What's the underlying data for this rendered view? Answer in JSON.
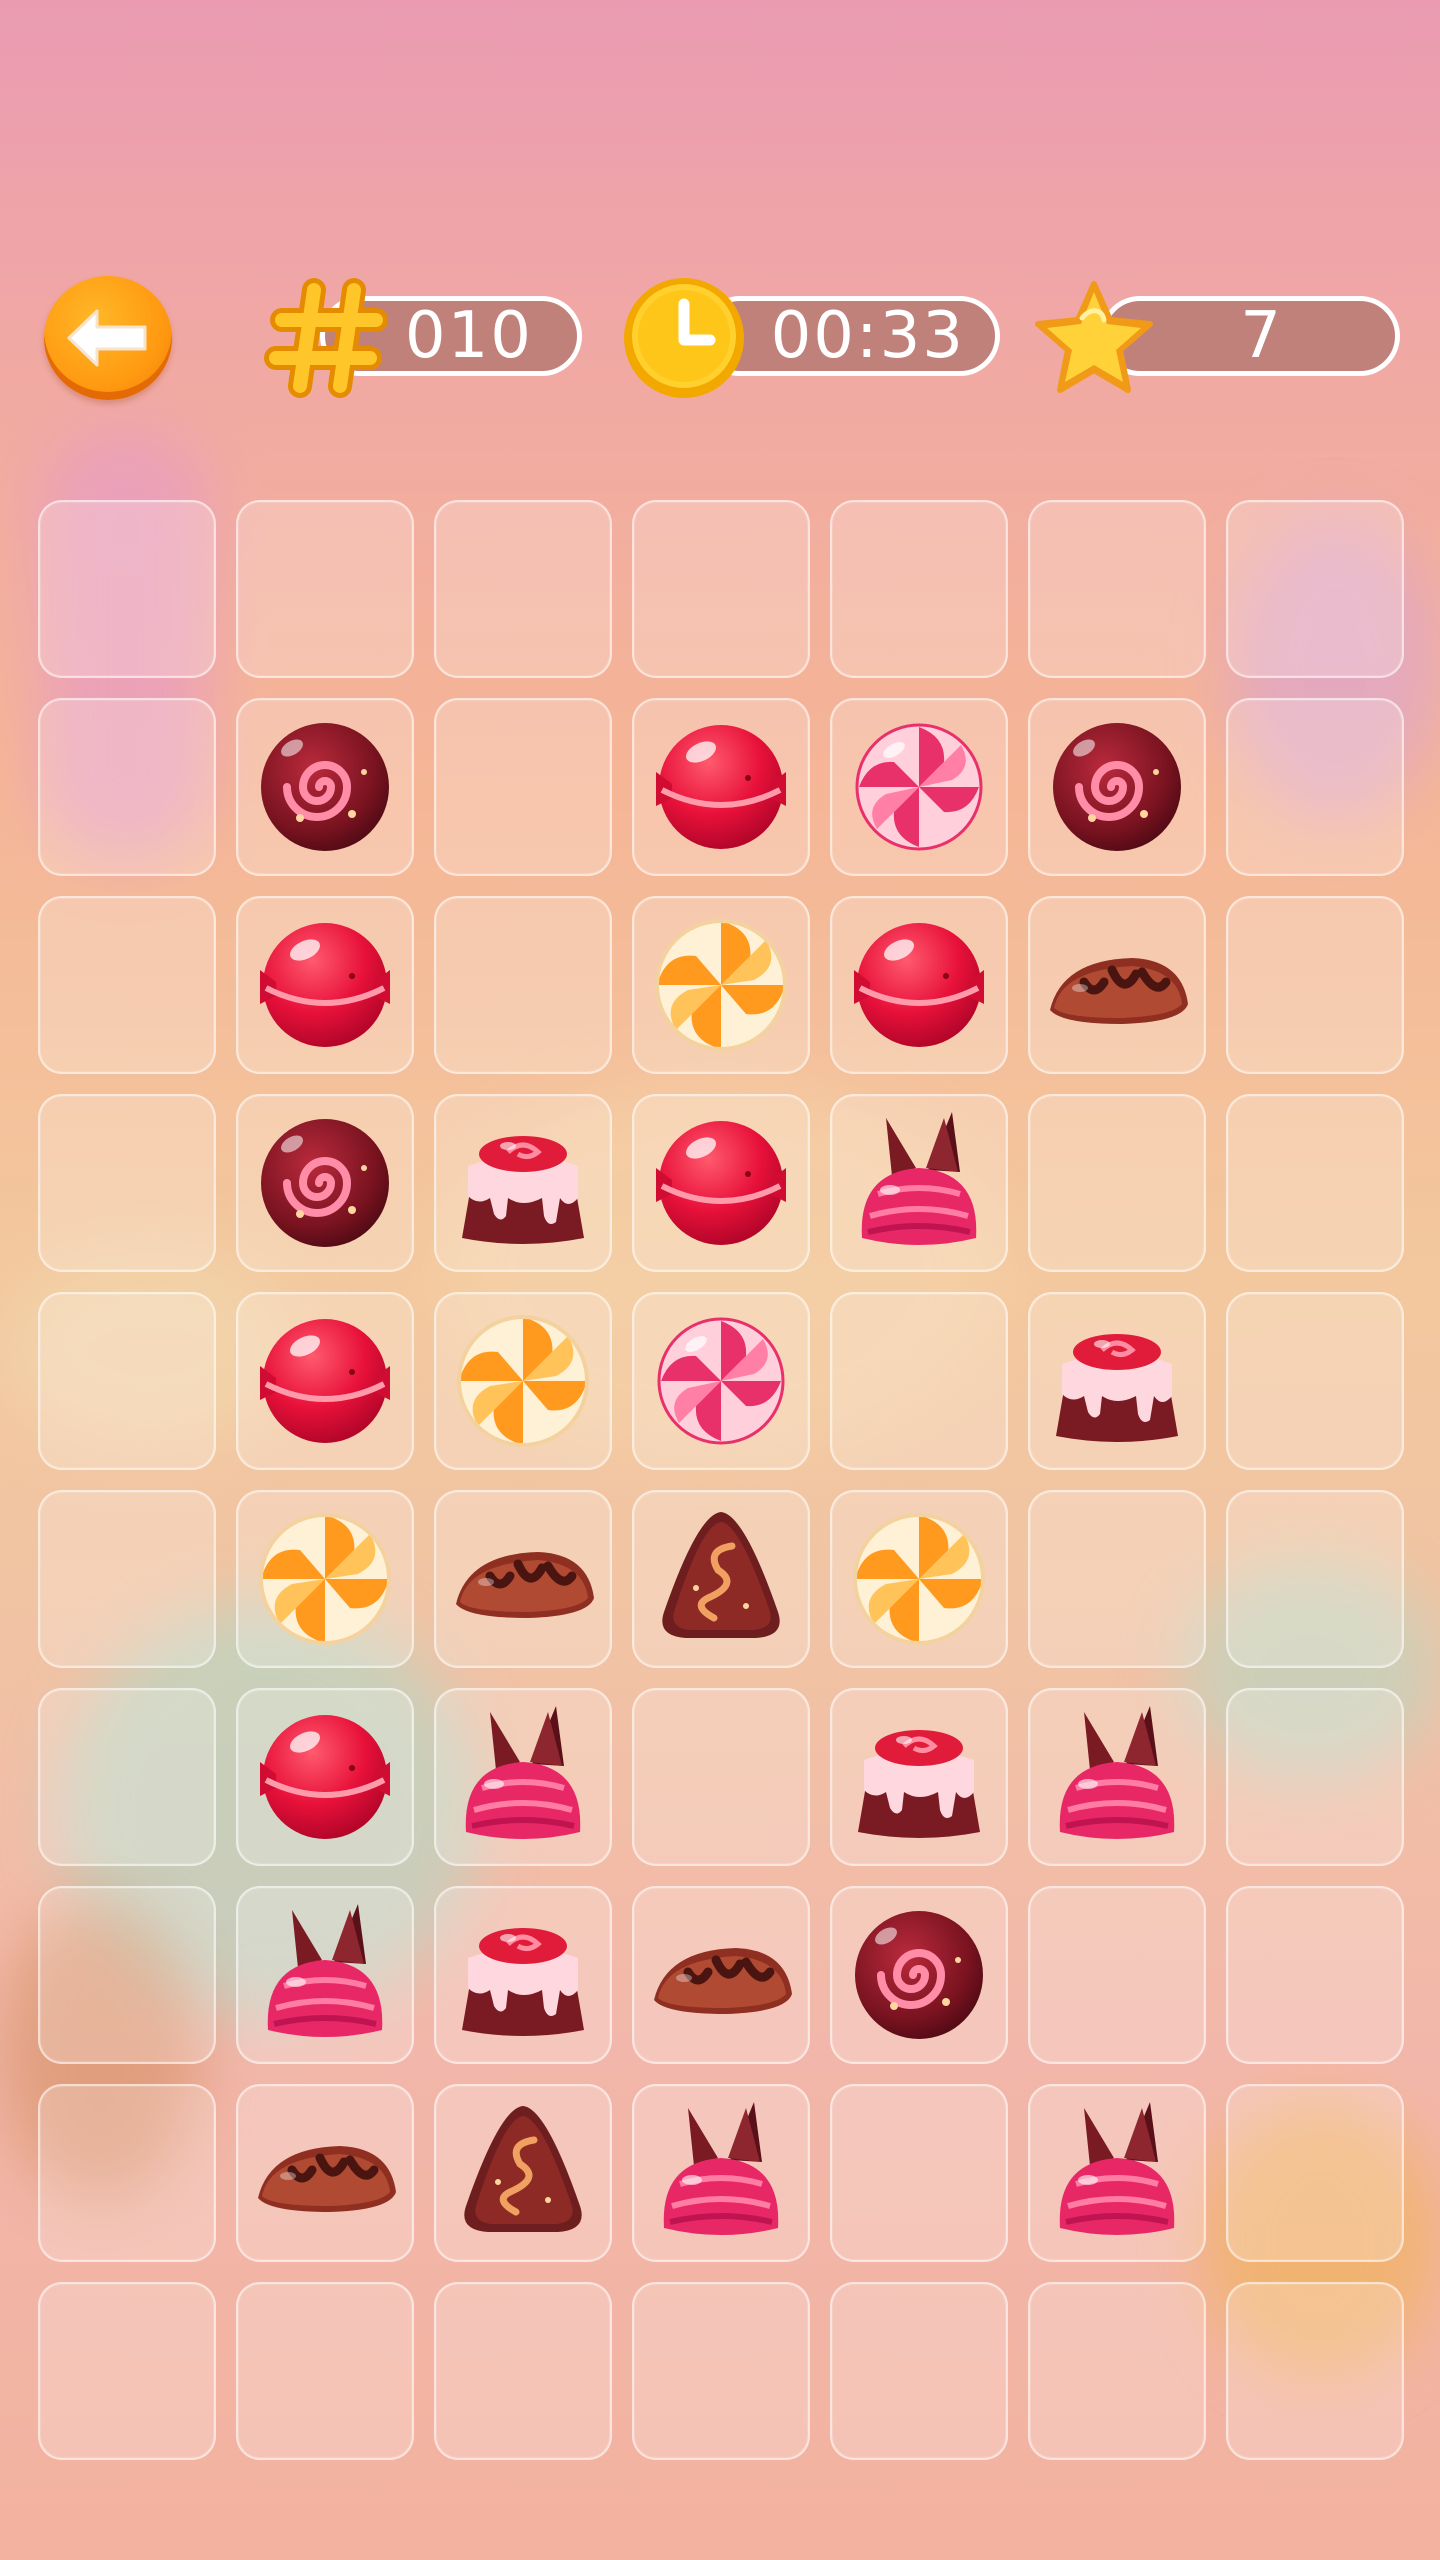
{
  "hud": {
    "moves_value": "010",
    "timer_value": "00:33",
    "stars_value": "7",
    "icons": [
      "back-arrow-icon",
      "hash-icon",
      "clock-icon",
      "star-icon"
    ],
    "colors": {
      "accent": "#ffb81c",
      "pill_fill": "#b0746e",
      "pill_border": "#ffffff"
    }
  },
  "board": {
    "rows": 10,
    "cols": 7,
    "tiles": [
      [
        "",
        "",
        "",
        "",
        "",
        "",
        ""
      ],
      [
        "",
        "chocolate-swirl-ball",
        "",
        "red-lollipop",
        "pink-swirl-lollipop",
        "chocolate-swirl-ball",
        ""
      ],
      [
        "",
        "red-lollipop",
        "",
        "orange-swirl-lollipop",
        "red-lollipop",
        "chocolate-eclair",
        ""
      ],
      [
        "",
        "chocolate-swirl-ball",
        "pudding-cake",
        "red-lollipop",
        "pink-chocolate-truffle",
        "",
        ""
      ],
      [
        "",
        "red-lollipop",
        "orange-swirl-lollipop",
        "pink-swirl-lollipop",
        "",
        "pudding-cake",
        ""
      ],
      [
        "",
        "orange-swirl-lollipop",
        "chocolate-eclair",
        "chocolate-pyramid",
        "orange-swirl-lollipop",
        "",
        ""
      ],
      [
        "",
        "red-lollipop",
        "pink-chocolate-truffle",
        "",
        "pudding-cake",
        "pink-chocolate-truffle",
        ""
      ],
      [
        "",
        "pink-chocolate-truffle",
        "pudding-cake",
        "chocolate-eclair",
        "chocolate-swirl-ball",
        "",
        ""
      ],
      [
        "",
        "chocolate-eclair",
        "chocolate-pyramid",
        "pink-chocolate-truffle",
        "",
        "pink-chocolate-truffle",
        ""
      ],
      [
        "",
        "",
        "",
        "",
        "",
        "",
        ""
      ]
    ]
  }
}
